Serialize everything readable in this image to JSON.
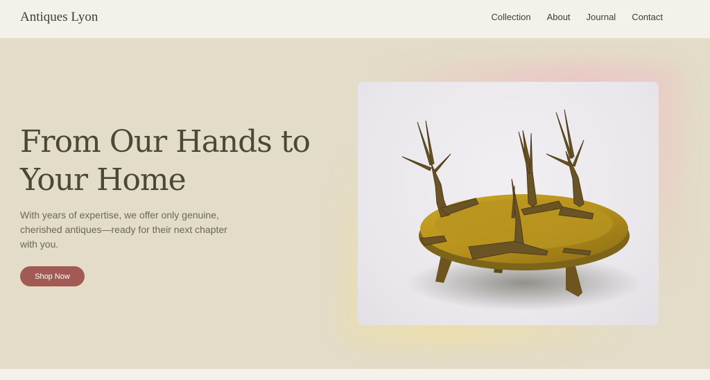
{
  "header": {
    "brand": "Antiques Lyon",
    "nav": [
      "Collection",
      "About",
      "Journal",
      "Contact"
    ]
  },
  "hero": {
    "title": "From Our Hands to Your Home",
    "subtitle": "With years of expertise, we offer only genuine, cherished antiques—ready for their next chapter with you.",
    "cta": "Shop Now"
  },
  "colors": {
    "background": "#f4f1ea",
    "hero_bg": "#e3dcc8",
    "accent": "#a35a55",
    "text": "#4a4838"
  }
}
